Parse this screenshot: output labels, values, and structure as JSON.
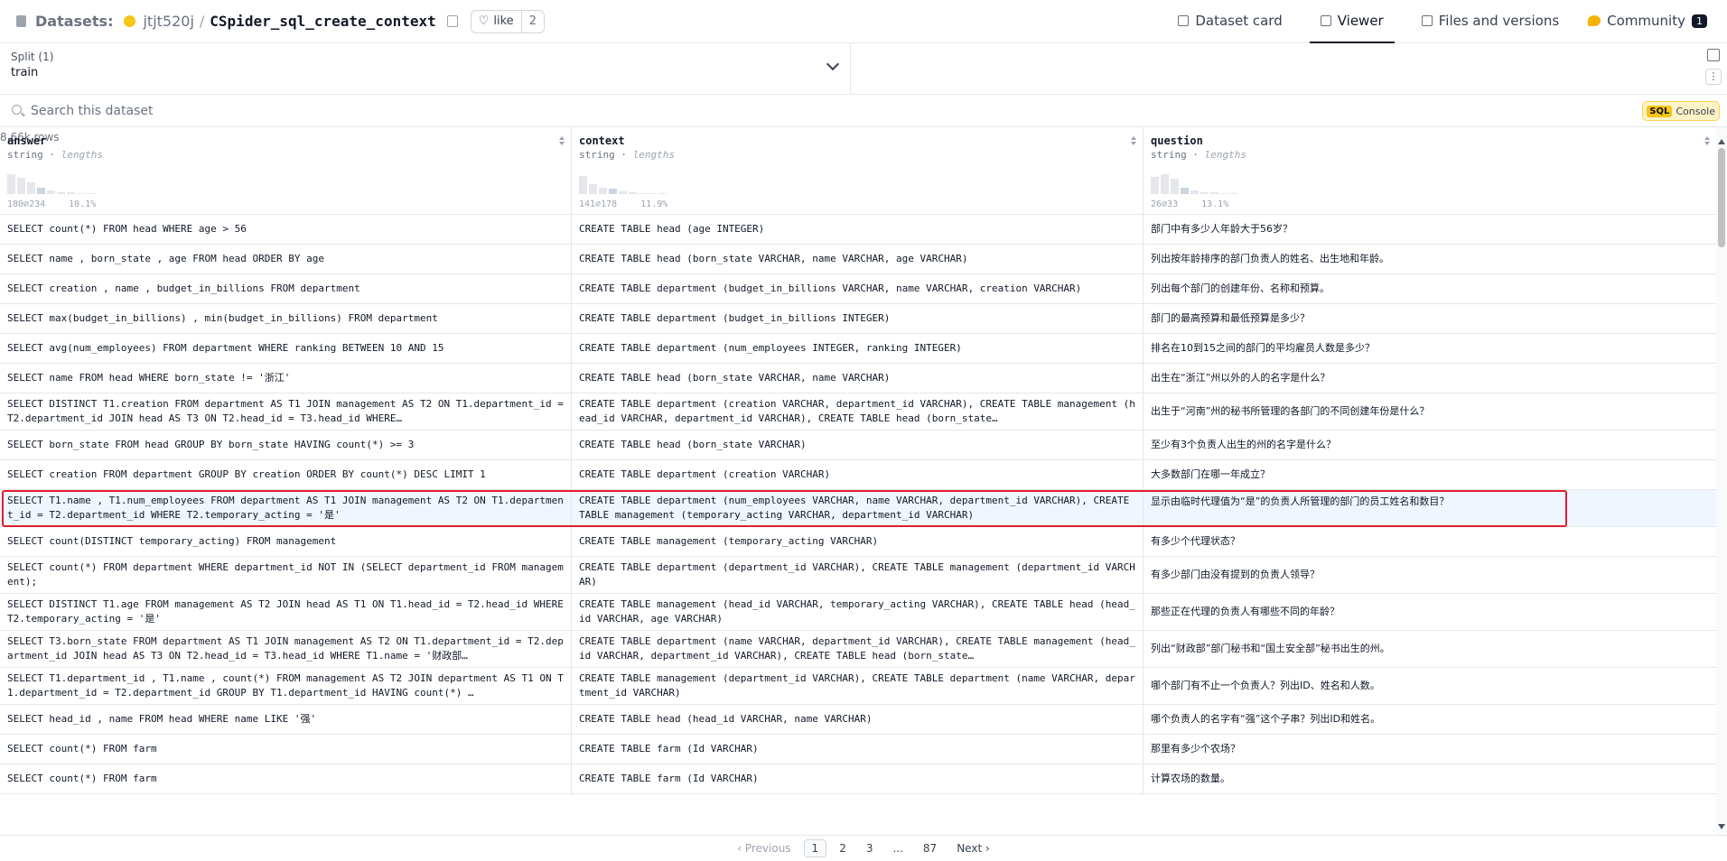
{
  "header": {
    "crumb_label": "Datasets:",
    "owner": "jtjt520j",
    "separator": "/",
    "repo": "CSpider_sql_create_context",
    "like_label": "like",
    "like_count": "2",
    "nav": [
      {
        "label": "Dataset card"
      },
      {
        "label": "Viewer"
      },
      {
        "label": "Files and versions"
      },
      {
        "label": "Community",
        "badge": "1"
      }
    ]
  },
  "split": {
    "title": "Split (1)",
    "value": "train",
    "dot": "·",
    "rows": "8.66k rows"
  },
  "search": {
    "placeholder": "Search this dataset",
    "sql_tag": "SQL",
    "sql_label": "Console"
  },
  "columns": [
    {
      "name": "answer",
      "type": "string",
      "stat": "lengths",
      "range": "180⌀234",
      "pct": "10.1%",
      "hist": [
        0.9,
        0.75,
        0.55,
        0.3,
        0.15,
        0.1,
        0.08,
        0.05,
        0.04
      ]
    },
    {
      "name": "context",
      "type": "string",
      "stat": "lengths",
      "range": "141⌀178",
      "pct": "11.9%",
      "hist": [
        0.85,
        0.45,
        0.3,
        0.25,
        0.12,
        0.1,
        0.06,
        0.05,
        0.04
      ]
    },
    {
      "name": "question",
      "type": "string",
      "stat": "lengths",
      "range": "26⌀33",
      "pct": "13.1%",
      "hist": [
        0.8,
        0.9,
        0.7,
        0.3,
        0.15,
        0.1,
        0.08,
        0.06,
        0.04
      ]
    }
  ],
  "rows": [
    {
      "answer": "SELECT count(*) FROM head WHERE age > 56",
      "context": "CREATE TABLE head (age INTEGER)",
      "question": "部门中有多少人年龄大于56岁？"
    },
    {
      "answer": "SELECT name , born_state , age FROM head ORDER BY age",
      "context": "CREATE TABLE head (born_state VARCHAR, name VARCHAR, age VARCHAR)",
      "question": "列出按年龄排序的部门负责人的姓名、出生地和年龄。"
    },
    {
      "answer": "SELECT creation , name , budget_in_billions FROM department",
      "context": "CREATE TABLE department (budget_in_billions VARCHAR, name VARCHAR, creation VARCHAR)",
      "question": "列出每个部门的创建年份、名称和预算。"
    },
    {
      "answer": "SELECT max(budget_in_billions) , min(budget_in_billions) FROM department",
      "context": "CREATE TABLE department (budget_in_billions INTEGER)",
      "question": "部门的最高预算和最低预算是多少？"
    },
    {
      "answer": "SELECT avg(num_employees) FROM department WHERE ranking BETWEEN 10 AND 15",
      "context": "CREATE TABLE department (num_employees INTEGER, ranking INTEGER)",
      "question": "排名在10到15之间的部门的平均雇员人数是多少？"
    },
    {
      "answer": "SELECT name FROM head WHERE born_state != '浙江'",
      "context": "CREATE TABLE head (born_state VARCHAR, name VARCHAR)",
      "question": "出生在“浙江”州以外的人的名字是什么？"
    },
    {
      "answer": "SELECT DISTINCT T1.creation FROM department AS T1 JOIN management AS T2 ON T1.department_id = T2.department_id JOIN head AS T3 ON T2.head_id = T3.head_id WHERE…",
      "context": "CREATE TABLE department (creation VARCHAR, department_id VARCHAR), CREATE TABLE management (head_id VARCHAR, department_id VARCHAR), CREATE TABLE head (born_state…",
      "question": "出生于“河南”州的秘书所管理的各部门的不同创建年份是什么？"
    },
    {
      "answer": "SELECT born_state FROM head GROUP BY born_state HAVING count(*) >= 3",
      "context": "CREATE TABLE head (born_state VARCHAR)",
      "question": "至少有3个负责人出生的州的名字是什么？"
    },
    {
      "answer": "SELECT creation FROM department GROUP BY creation ORDER BY count(*) DESC LIMIT 1",
      "context": "CREATE TABLE department (creation VARCHAR)",
      "question": "大多数部门在哪一年成立？"
    },
    {
      "answer": "SELECT T1.name , T1.num_employees FROM department AS T1 JOIN management AS T2 ON T1.department_id = T2.department_id WHERE T2.temporary_acting = '是'",
      "context": "CREATE TABLE department (num_employees VARCHAR, name VARCHAR, department_id VARCHAR), CREATE TABLE management (temporary_acting VARCHAR, department_id VARCHAR)",
      "question": "显示由临时代理值为“是”的负责人所管理的部门的员工姓名和数目？"
    },
    {
      "answer": "SELECT count(DISTINCT temporary_acting) FROM management",
      "context": "CREATE TABLE management (temporary_acting VARCHAR)",
      "question": "有多少个代理状态？"
    },
    {
      "answer": "SELECT count(*) FROM department WHERE department_id NOT IN (SELECT department_id FROM management);",
      "context": "CREATE TABLE department (department_id VARCHAR), CREATE TABLE management (department_id VARCHAR)",
      "question": "有多少部门由没有提到的负责人领导？"
    },
    {
      "answer": "SELECT DISTINCT T1.age FROM management AS T2 JOIN head AS T1 ON T1.head_id = T2.head_id WHERE T2.temporary_acting = '是'",
      "context": "CREATE TABLE management (head_id VARCHAR, temporary_acting VARCHAR), CREATE TABLE head (head_id VARCHAR, age VARCHAR)",
      "question": "那些正在代理的负责人有哪些不同的年龄？"
    },
    {
      "answer": "SELECT T3.born_state FROM department AS T1 JOIN management AS T2 ON T1.department_id = T2.department_id JOIN head AS T3 ON T2.head_id = T3.head_id WHERE T1.name = '财政部…",
      "context": "CREATE TABLE department (name VARCHAR, department_id VARCHAR), CREATE TABLE management (head_id VARCHAR, department_id VARCHAR), CREATE TABLE head (born_state…",
      "question": "列出“财政部”部门秘书和“国土安全部”秘书出生的州。"
    },
    {
      "answer": "SELECT T1.department_id , T1.name , count(*) FROM management AS T2 JOIN department AS T1 ON T1.department_id = T2.department_id GROUP BY T1.department_id HAVING count(*) …",
      "context": "CREATE TABLE management (department_id VARCHAR), CREATE TABLE department (name VARCHAR, department_id VARCHAR)",
      "question": "哪个部门有不止一个负责人？列出ID、姓名和人数。"
    },
    {
      "answer": "SELECT head_id , name FROM head WHERE name LIKE '强'",
      "context": "CREATE TABLE head (head_id VARCHAR, name VARCHAR)",
      "question": "哪个负责人的名字有“强”这个子串？列出ID和姓名。"
    },
    {
      "answer": "SELECT count(*) FROM farm",
      "context": "CREATE TABLE farm (Id VARCHAR)",
      "question": "那里有多少个农场？"
    },
    {
      "answer": "SELECT count(*) FROM farm",
      "context": "CREATE TABLE farm (Id VARCHAR)",
      "question": "计算农场的数量。"
    }
  ],
  "highlighted_row": 9,
  "pager": {
    "prev": "‹ Previous",
    "pages": [
      "1",
      "2",
      "3",
      "...",
      "87"
    ],
    "current": "1",
    "next": "Next ›"
  },
  "colors": {
    "highlight_border": "#e11d2e",
    "highlight_bg": "#eff6ff",
    "accent_yellow": "#f5c518"
  }
}
